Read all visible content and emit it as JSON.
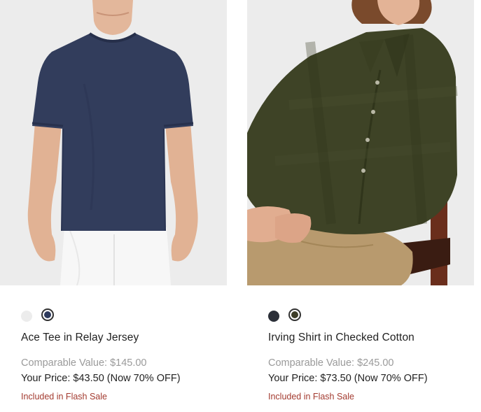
{
  "products": [
    {
      "title": "Ace Tee in Relay Jersey",
      "comparable_value": "Comparable Value: $145.00",
      "your_price": "Your Price: $43.50 (Now 70% OFF)",
      "sale_tag": "Included in Flash Sale",
      "image": "navy-tee-photo",
      "swatches": [
        {
          "color": "#ececec",
          "selected": false
        },
        {
          "color": "#2e3a5c",
          "selected": true
        }
      ]
    },
    {
      "title": "Irving Shirt in Checked Cotton",
      "comparable_value": "Comparable Value: $245.00",
      "your_price": "Your Price: $73.50 (Now 70% OFF)",
      "sale_tag": "Included in Flash Sale",
      "image": "olive-shirt-photo",
      "swatches": [
        {
          "color": "#2b2f38",
          "selected": false
        },
        {
          "color": "#3d3d28",
          "selected": true
        }
      ]
    }
  ],
  "colors": {
    "sale_red": "#a33b30",
    "muted_gray": "#9a9a9a",
    "photo_bg": "#ececec"
  }
}
